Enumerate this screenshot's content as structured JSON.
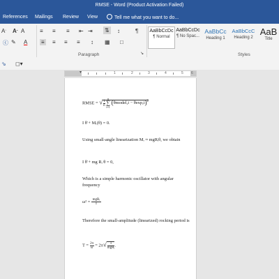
{
  "window": {
    "title": "RMSE - Word (Product Activation Failed)"
  },
  "tabs": [
    "References",
    "Mailings",
    "Review",
    "View"
  ],
  "tell_me": "Tell me what you want to do...",
  "ribbon": {
    "groups": {
      "paragraph": "Paragraph",
      "styles": "Styles"
    },
    "styles": [
      {
        "sample": "AaBbCcDc",
        "name": "¶ Normal"
      },
      {
        "sample": "AaBbCcDc",
        "name": "¶ No Spac..."
      },
      {
        "sample": "AaBbCc",
        "name": "Heading 1"
      },
      {
        "sample": "AaBbCcC",
        "name": "Heading 2"
      },
      {
        "sample": "AaB",
        "name": "Title"
      }
    ],
    "icons": [
      "font-grow-icon",
      "bullets-icon",
      "numbering-icon",
      "multilevel-list-icon",
      "decrease-indent-icon",
      "increase-indent-icon",
      "sort-icon",
      "pilcrow-icon",
      "align-left-icon",
      "align-center-icon",
      "align-right-icon",
      "justify-icon",
      "line-spacing-icon",
      "shading-icon",
      "borders-icon"
    ]
  },
  "ruler": {
    "numbers": [
      "1",
      "2",
      "3",
      "4",
      "5",
      "6"
    ]
  },
  "document": {
    "p1": {
      "prefix": "RMSE = ",
      "frac_num": "1",
      "frac_den": "n",
      "sum_top": "n",
      "sum_bot": "i=1",
      "body": "θmodel,i − θexp,i",
      "exp": "2"
    },
    "p2": "I θ̈ + Mᵣ(θ) = 0.",
    "p3": "Using small-angle linearization Mᵣ ≈ mgRᵢθ, we obtain",
    "p4": "I θ̈ + mg Rᵢ θ = 0,",
    "p5": "Which is a simple harmonic oscillator with angular frequency",
    "p6": {
      "lhs": "ω² = ",
      "num": "mgRᵢ",
      "den": "I"
    },
    "p7": "Therefore the small-amplitude (linearized) rocking period is",
    "p8": {
      "lhs": "T = ",
      "f1_num": "2π",
      "f1_den": "ω",
      "mid": " = 2π",
      "root_num": "I",
      "root_den": "mgRᵢ"
    }
  }
}
